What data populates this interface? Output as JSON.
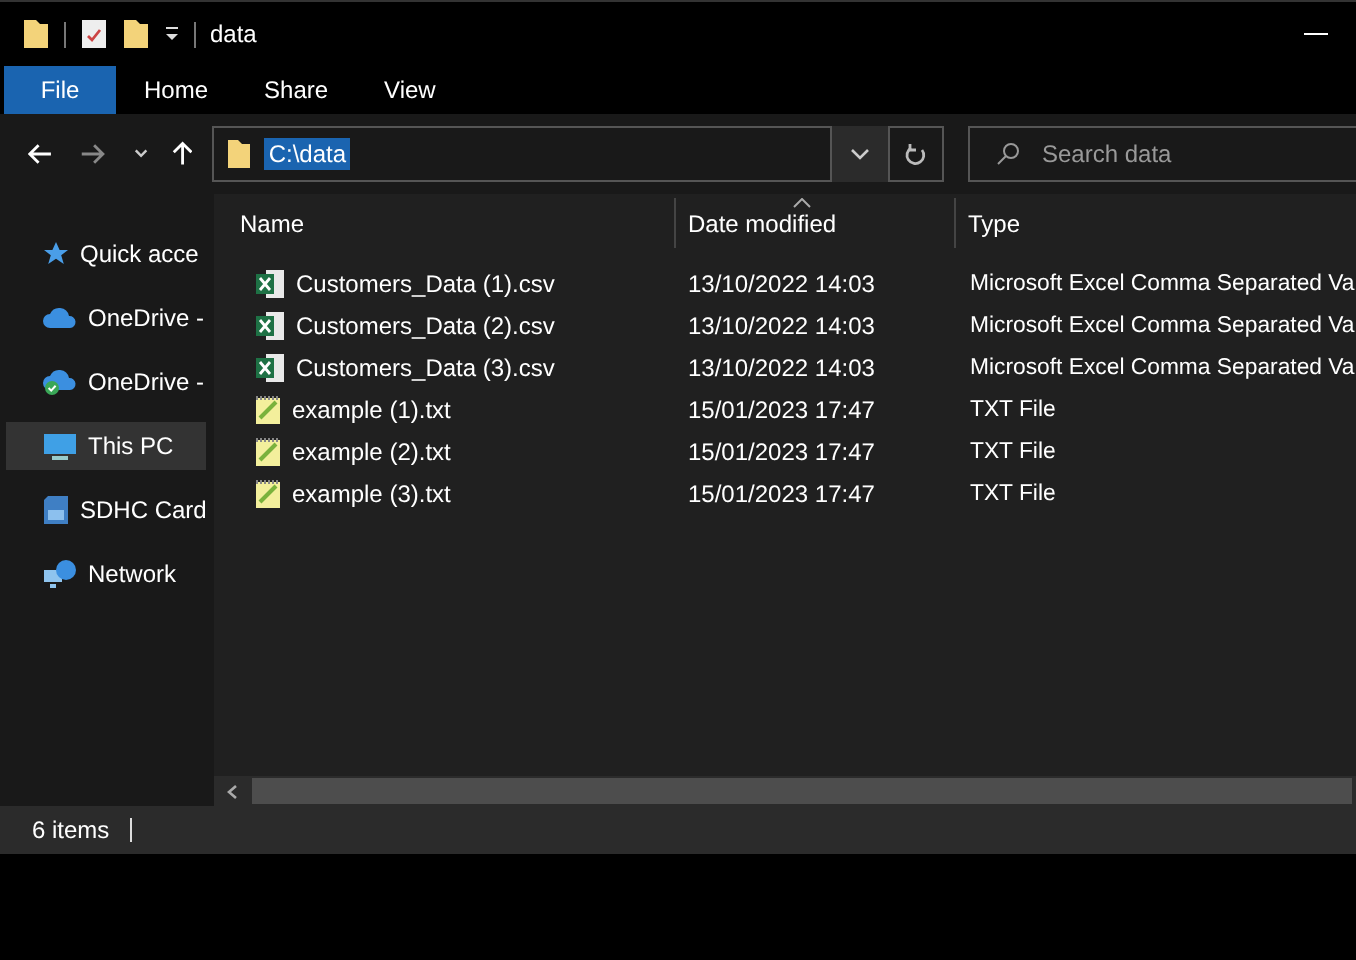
{
  "window": {
    "title": "data"
  },
  "ribbon_tabs": [
    {
      "label": "File",
      "selected": true
    },
    {
      "label": "Home",
      "selected": false
    },
    {
      "label": "Share",
      "selected": false
    },
    {
      "label": "View",
      "selected": false
    }
  ],
  "address_bar": {
    "path": "C:\\data",
    "path_selected": true
  },
  "search": {
    "placeholder": "Search data"
  },
  "sidebar": {
    "items": [
      {
        "label": "Quick acce",
        "kind": "star",
        "selected": false
      },
      {
        "label": "OneDrive -",
        "kind": "cloud",
        "selected": false
      },
      {
        "label": "OneDrive -",
        "kind": "cloud-check",
        "selected": false
      },
      {
        "label": "This PC",
        "kind": "pc",
        "selected": true
      },
      {
        "label": "SDHC Card",
        "kind": "card",
        "selected": false
      },
      {
        "label": "Network",
        "kind": "network",
        "selected": false
      }
    ]
  },
  "table": {
    "columns": [
      {
        "label": "Name",
        "sorted": false
      },
      {
        "label": "Date modified",
        "sorted": true
      },
      {
        "label": "Type",
        "sorted": false
      }
    ],
    "rows": [
      {
        "kind": "csv",
        "name": "Customers_Data (1).csv",
        "date": "13/10/2022 14:03",
        "type": "Microsoft Excel Comma Separated Va"
      },
      {
        "kind": "csv",
        "name": "Customers_Data (2).csv",
        "date": "13/10/2022 14:03",
        "type": "Microsoft Excel Comma Separated Va"
      },
      {
        "kind": "csv",
        "name": "Customers_Data (3).csv",
        "date": "13/10/2022 14:03",
        "type": "Microsoft Excel Comma Separated Va"
      },
      {
        "kind": "txt",
        "name": "example (1).txt",
        "date": "15/01/2023 17:47",
        "type": "TXT File"
      },
      {
        "kind": "txt",
        "name": "example (2).txt",
        "date": "15/01/2023 17:47",
        "type": "TXT File"
      },
      {
        "kind": "txt",
        "name": "example (3).txt",
        "date": "15/01/2023 17:47",
        "type": "TXT File"
      }
    ]
  },
  "status_bar": {
    "item_count": "6 items"
  }
}
